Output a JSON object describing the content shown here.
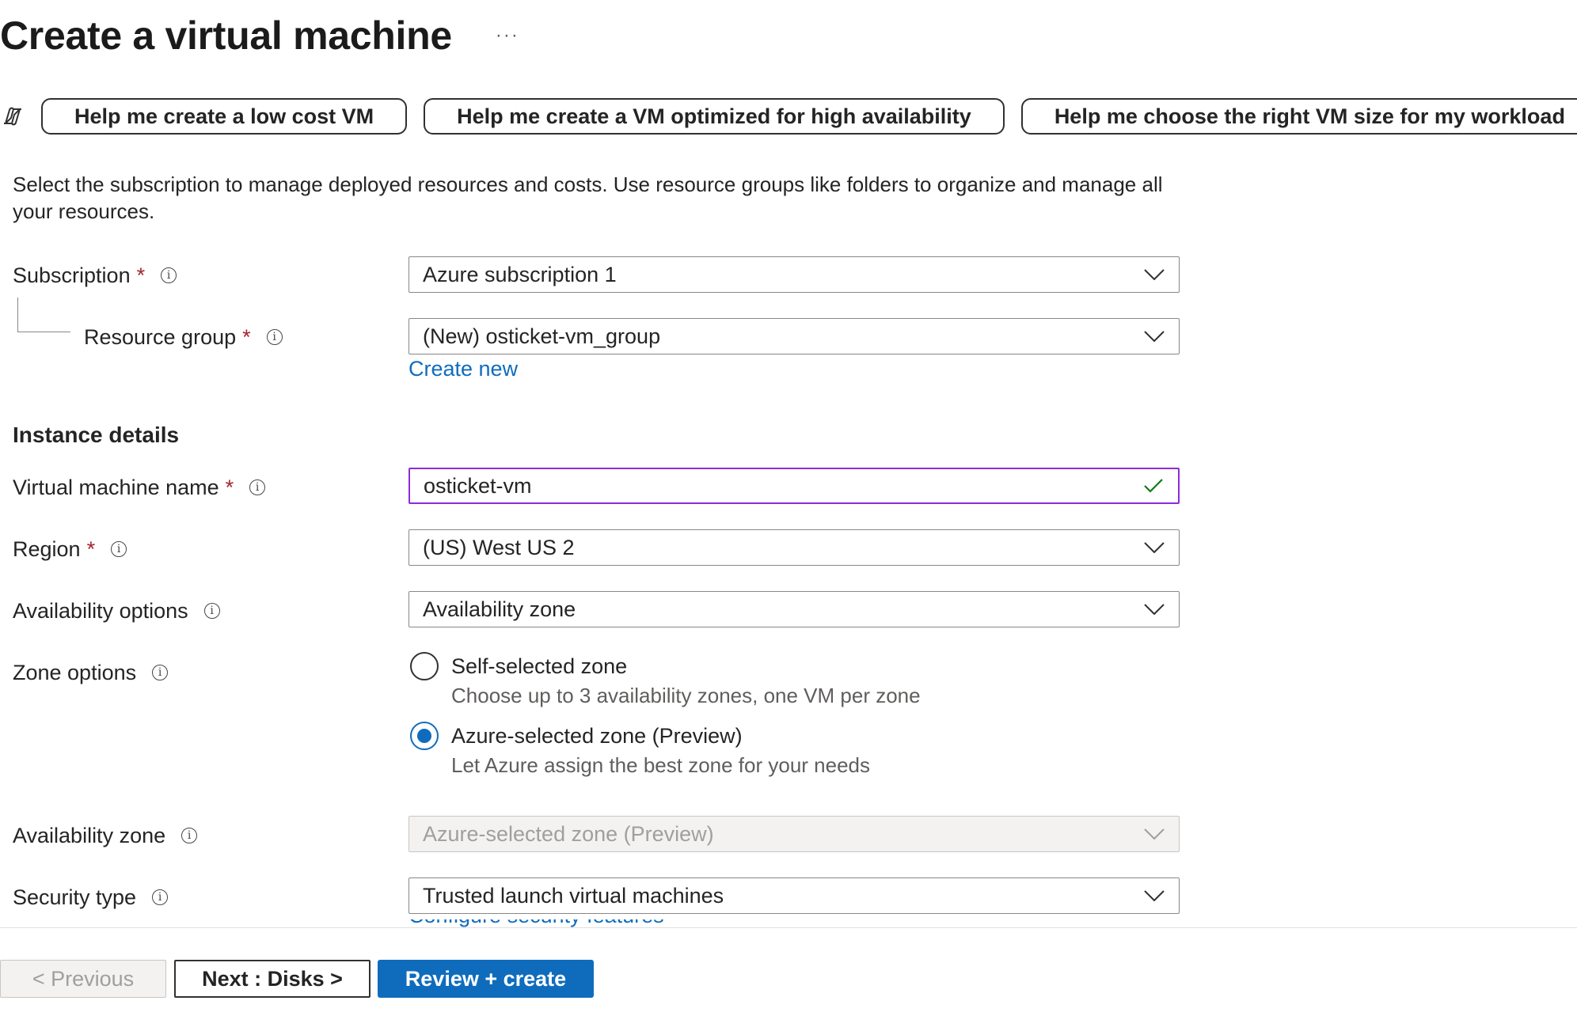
{
  "page": {
    "title": "Create a virtual machine",
    "more_label": "···"
  },
  "copilot": {
    "icon": "copilot-icon",
    "buttons": [
      "Help me create a low cost VM",
      "Help me create a VM optimized for high availability",
      "Help me choose the right VM size for my workload"
    ]
  },
  "description": "Select the subscription to manage deployed resources and costs. Use resource groups like folders to organize and manage all your resources.",
  "project": {
    "subscription": {
      "label": "Subscription",
      "required": "*",
      "value": "Azure subscription 1"
    },
    "resource_group": {
      "label": "Resource group",
      "required": "*",
      "value": "(New) osticket-vm_group",
      "create_new": "Create new"
    }
  },
  "instance": {
    "section_title": "Instance details",
    "vm_name": {
      "label": "Virtual machine name",
      "required": "*",
      "value": "osticket-vm",
      "valid": true
    },
    "region": {
      "label": "Region",
      "required": "*",
      "value": "(US) West US 2"
    },
    "availability_options": {
      "label": "Availability options",
      "value": "Availability zone"
    },
    "zone_options": {
      "label": "Zone options",
      "options": [
        {
          "label": "Self-selected zone",
          "description": "Choose up to 3 availability zones, one VM per zone",
          "selected": false
        },
        {
          "label": "Azure-selected zone (Preview)",
          "description": "Let Azure assign the best zone for your needs",
          "selected": true
        }
      ]
    },
    "availability_zone": {
      "label": "Availability zone",
      "value": "Azure-selected zone (Preview)",
      "disabled": true
    },
    "security_type": {
      "label": "Security type",
      "value": "Trusted launch virtual machines",
      "configure_link": "Configure security features"
    }
  },
  "footer": {
    "previous": "< Previous",
    "next": "Next : Disks >",
    "review": "Review + create"
  },
  "colors": {
    "accent": "#0f6cbd",
    "required": "#a4262c",
    "focus_border": "#8d2bd9",
    "valid_check": "#107c10"
  }
}
